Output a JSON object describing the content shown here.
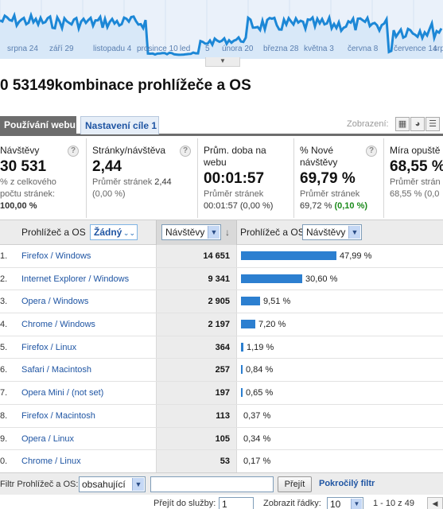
{
  "sparkline": {
    "labels": [
      "srpna 24",
      "září 29",
      "listopadu 4",
      "prosince 10",
      "led",
      "5",
      "února 20",
      "března 28",
      "května 3",
      "června 8",
      "července 14",
      "srp"
    ]
  },
  "page_title": "0 53149kombinace prohlížeče a OS",
  "tabs": {
    "active": "Používání webu",
    "inactive": "Nastavení cíle 1"
  },
  "view": {
    "label": "Zobrazení:",
    "icons": [
      "table-view-icon",
      "pie-view-icon",
      "bar-view-icon"
    ]
  },
  "metrics": [
    {
      "label": "Návštěvy",
      "value": "30 531",
      "sub1": "% z celkového",
      "sub2": "počtu stránek:",
      "sub3": "100,00 %"
    },
    {
      "label": "Stránky/návštěva",
      "value": "2,44",
      "sub1": "Průměr stránek",
      "sub1b": "2,44",
      "sub2": "(0,00 %)"
    },
    {
      "label": "Prům. doba na webu",
      "value": "00:01:57",
      "sub1": "Průměr stránek",
      "sub2": "00:01:57 (0,00 %)"
    },
    {
      "label": "% Nové návštěvy",
      "value": "69,79 %",
      "sub1": "Průměr stránek",
      "sub2": "69,72 %",
      "sub2b": "(0,10 %)"
    },
    {
      "label": "Míra opuště",
      "value": "68,55 %",
      "sub1": "Průměr strán",
      "sub2": "68,55 % (0,0"
    }
  ],
  "table": {
    "header": {
      "dimension": "Prohlížeč a OS",
      "segment": "Žádný",
      "metric": "Návštěvy",
      "chart_dimension": "Prohlížeč a OS",
      "chart_metric": "Návštěvy"
    },
    "rows": [
      {
        "idx": "1.",
        "name": "Firefox / Windows",
        "visits": "14 651",
        "pct": "47,99 %",
        "share": 47.99
      },
      {
        "idx": "2.",
        "name": "Internet Explorer / Windows",
        "visits": "9 341",
        "pct": "30,60 %",
        "share": 30.6
      },
      {
        "idx": "3.",
        "name": "Opera / Windows",
        "visits": "2 905",
        "pct": "9,51 %",
        "share": 9.51
      },
      {
        "idx": "4.",
        "name": "Chrome / Windows",
        "visits": "2 197",
        "pct": "7,20 %",
        "share": 7.2
      },
      {
        "idx": "5.",
        "name": "Firefox / Linux",
        "visits": "364",
        "pct": "1,19 %",
        "share": 1.19
      },
      {
        "idx": "6.",
        "name": "Safari / Macintosh",
        "visits": "257",
        "pct": "0,84 %",
        "share": 0.84
      },
      {
        "idx": "7.",
        "name": "Opera Mini / (not set)",
        "visits": "197",
        "pct": "0,65 %",
        "share": 0.65
      },
      {
        "idx": "8.",
        "name": "Firefox / Macintosh",
        "visits": "113",
        "pct": "0,37 %",
        "share": 0.37
      },
      {
        "idx": "9.",
        "name": "Opera / Linux",
        "visits": "105",
        "pct": "0,34 %",
        "share": 0.34
      },
      {
        "idx": "0.",
        "name": "Chrome / Linux",
        "visits": "53",
        "pct": "0,17 %",
        "share": 0.17
      }
    ]
  },
  "filter": {
    "label": "Filtr Prohlížeč a OS:",
    "mode": "obsahující",
    "value": "",
    "button": "Přejít",
    "advanced": "Pokročilý filtr"
  },
  "pager": {
    "goto_label": "Přejít do služby:",
    "goto_value": "1",
    "rows_label": "Zobrazit řádky:",
    "rows_value": "10",
    "range": "1 - 10 z 49"
  },
  "colors": {
    "accent": "#1f55a3",
    "bar": "#2c7fd0",
    "spark_line": "#1c87d6",
    "spark_fill": "#d8e8f8"
  }
}
